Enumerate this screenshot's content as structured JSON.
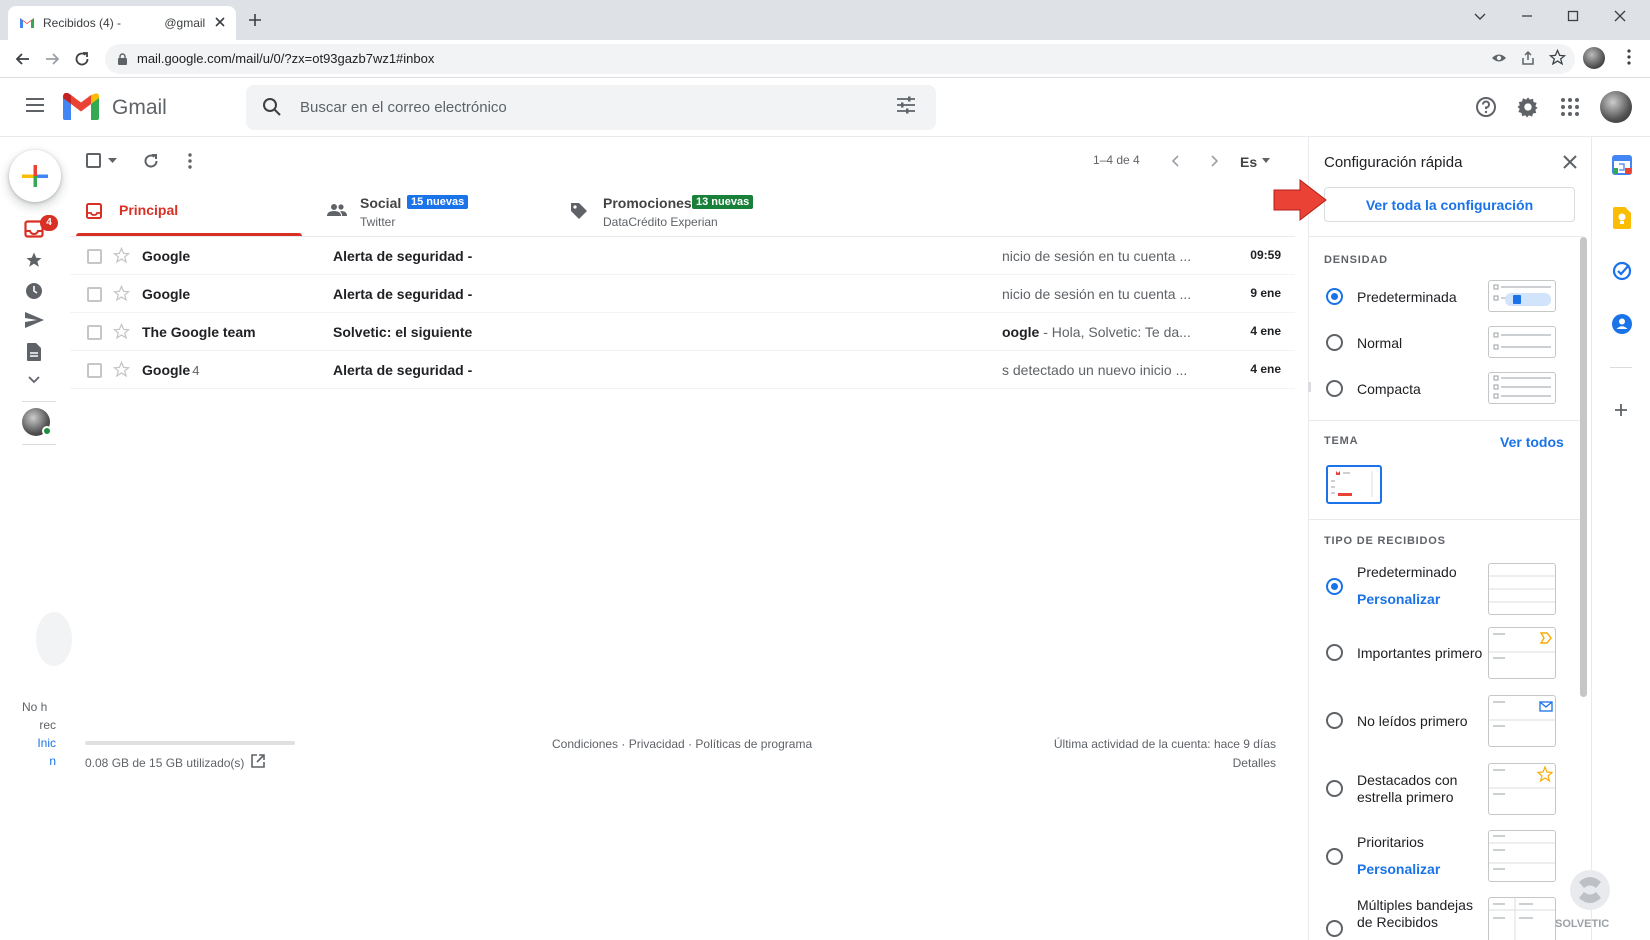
{
  "browser": {
    "tab_title": "Recibidos (4) -             @gmail",
    "url": "mail.google.com/mail/u/0/?zx=ot93gazb7wz1#inbox"
  },
  "gmail": {
    "brand": "Gmail",
    "search_placeholder": "Buscar en el correo electrónico",
    "badge_count": "4",
    "left_message": [
      "No h",
      "rec",
      "Inic",
      "n"
    ]
  },
  "toolbar": {
    "paging": "1–4 de 4",
    "lang": "Es"
  },
  "tabs": [
    {
      "label": "Principal",
      "color": "#d93025"
    },
    {
      "label": "Social",
      "badge": "15 nuevas",
      "badge_color": "#1a73e8",
      "sub": "Twitter"
    },
    {
      "label": "Promociones",
      "badge": "13 nuevas",
      "badge_color": "#188038",
      "sub": "DataCrédito Experian"
    }
  ],
  "emails": [
    {
      "from": "Google",
      "count": "",
      "subject": "Alerta de seguridad -",
      "snippet_bold": "",
      "snippet": "nicio de sesión en tu cuenta ...",
      "date": "09:59"
    },
    {
      "from": "Google",
      "count": "",
      "subject": "Alerta de seguridad -",
      "snippet_bold": "",
      "snippet": "nicio de sesión en tu cuenta ...",
      "date": "9 ene"
    },
    {
      "from": "The Google team",
      "count": "",
      "subject": "Solvetic: el siguiente",
      "snippet_bold": "oogle",
      "snippet": " - Hola, Solvetic: Te da...",
      "date": "4 ene"
    },
    {
      "from": "Google",
      "count": "4",
      "subject": "Alerta de seguridad -",
      "snippet_bold": "",
      "snippet": "s detectado un nuevo inicio ...",
      "date": "4 ene"
    }
  ],
  "footer": {
    "storage": "0.08 GB de 15 GB utilizado(s)",
    "links": "Condiciones · Privacidad · Políticas de programa",
    "last_activity": "Última actividad de la cuenta: hace 9 días",
    "details": "Detalles"
  },
  "quick_settings": {
    "title": "Configuración rápida",
    "all_settings": "Ver toda la configuración",
    "density_header": "DENSIDAD",
    "density": [
      {
        "label": "Predeterminada",
        "selected": true
      },
      {
        "label": "Normal",
        "selected": false
      },
      {
        "label": "Compacta",
        "selected": false
      }
    ],
    "theme_header": "TEMA",
    "theme_link": "Ver todos",
    "inbox_header": "TIPO DE RECIBIDOS",
    "inbox_types": [
      {
        "label": "Predeterminado",
        "link": "Personalizar",
        "selected": true
      },
      {
        "label": "Importantes primero",
        "link": "",
        "selected": false
      },
      {
        "label": "No leídos primero",
        "link": "",
        "selected": false
      },
      {
        "label": "Destacados con estrella primero",
        "link": "",
        "selected": false
      },
      {
        "label": "Prioritarios",
        "link": "Personalizar",
        "selected": false
      },
      {
        "label": "Múltiples bandejas de Recibidos",
        "link": "",
        "selected": false
      }
    ]
  },
  "icons": {
    "compose": "compose-plus-icon",
    "inbox": "inbox-icon",
    "starred": "star-icon",
    "snoozed": "clock-icon",
    "sent": "send-icon",
    "drafts": "draft-icon",
    "more": "chevron-down-icon"
  },
  "colors": {
    "accent": "#1a73e8",
    "gmail_red": "#d93025",
    "arrow": "#ea4335"
  },
  "watermark": "SOLVETIC"
}
